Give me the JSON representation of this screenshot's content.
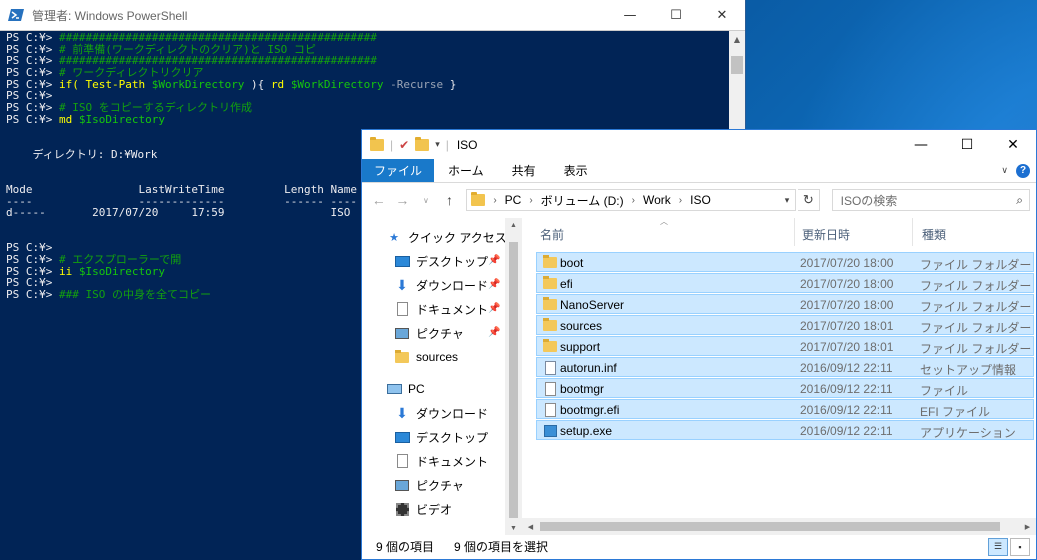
{
  "powershell": {
    "title": "管理者: Windows PowerShell",
    "lines": [
      [
        {
          "t": "PS C:¥> ",
          "c": "c-prompt"
        },
        {
          "t": "################################################",
          "c": "c-comment"
        }
      ],
      [
        {
          "t": "PS C:¥> ",
          "c": "c-prompt"
        },
        {
          "t": "# 前準備(ワークディレクトのクリア)と ISO コピ",
          "c": "c-comment"
        }
      ],
      [
        {
          "t": "PS C:¥> ",
          "c": "c-prompt"
        },
        {
          "t": "################################################",
          "c": "c-comment"
        }
      ],
      [
        {
          "t": "PS C:¥> ",
          "c": "c-prompt"
        },
        {
          "t": "# ワークディレクトリクリア",
          "c": "c-comment"
        }
      ],
      [
        {
          "t": "PS C:¥> ",
          "c": "c-prompt"
        },
        {
          "t": "if( ",
          "c": "c-cmd"
        },
        {
          "t": "Test-Path ",
          "c": "c-cmd"
        },
        {
          "t": "$WorkDirectory",
          "c": "c-var"
        },
        {
          "t": " ){ ",
          "c": "c-text"
        },
        {
          "t": "rd ",
          "c": "c-cmd"
        },
        {
          "t": "$WorkDirectory",
          "c": "c-var"
        },
        {
          "t": " -Recurse",
          "c": "c-param"
        },
        {
          "t": " }",
          "c": "c-text"
        }
      ],
      [
        {
          "t": "PS C:¥> ",
          "c": "c-prompt"
        }
      ],
      [
        {
          "t": "PS C:¥> ",
          "c": "c-prompt"
        },
        {
          "t": "# ISO をコピーするディレクトリ作成",
          "c": "c-comment"
        }
      ],
      [
        {
          "t": "PS C:¥> ",
          "c": "c-prompt"
        },
        {
          "t": "md ",
          "c": "c-cmd"
        },
        {
          "t": "$IsoDirectory",
          "c": "c-var"
        }
      ],
      [],
      [],
      [
        {
          "t": "    ディレクトリ: D:¥Work",
          "c": "c-text"
        }
      ],
      [],
      [],
      [
        {
          "t": "Mode                LastWriteTime         Length Name",
          "c": "c-text"
        }
      ],
      [
        {
          "t": "----                -------------         ------ ----",
          "c": "c-text"
        }
      ],
      [
        {
          "t": "d-----       2017/07/20     17:59                ISO",
          "c": "c-text"
        }
      ],
      [],
      [],
      [
        {
          "t": "PS C:¥> ",
          "c": "c-prompt"
        }
      ],
      [
        {
          "t": "PS C:¥> ",
          "c": "c-prompt"
        },
        {
          "t": "# エクスプローラーで開",
          "c": "c-comment"
        }
      ],
      [
        {
          "t": "PS C:¥> ",
          "c": "c-prompt"
        },
        {
          "t": "ii ",
          "c": "c-cmd"
        },
        {
          "t": "$IsoDirectory",
          "c": "c-var"
        }
      ],
      [
        {
          "t": "PS C:¥> ",
          "c": "c-prompt"
        }
      ],
      [
        {
          "t": "PS C:¥> ",
          "c": "c-prompt"
        },
        {
          "t": "### ISO の中身を全てコピー",
          "c": "c-comment"
        }
      ]
    ]
  },
  "explorer": {
    "title": "ISO",
    "tabs": [
      "ファイル",
      "ホーム",
      "共有",
      "表示"
    ],
    "address": [
      "PC",
      "ボリューム (D:)",
      "Work",
      "ISO"
    ],
    "search_placeholder": "ISOの検索",
    "columns": {
      "name": "名前",
      "date": "更新日時",
      "type": "種類"
    },
    "nav": {
      "quick_access": "クイック アクセス",
      "qa_items": [
        "デスクトップ",
        "ダウンロード",
        "ドキュメント",
        "ピクチャ",
        "sources"
      ],
      "pc": "PC",
      "pc_items": [
        "ダウンロード",
        "デスクトップ",
        "ドキュメント",
        "ピクチャ",
        "ビデオ"
      ]
    },
    "files": [
      {
        "name": "boot",
        "date": "2017/07/20 18:00",
        "type": "ファイル フォルダー",
        "icon": "folder-icon"
      },
      {
        "name": "efi",
        "date": "2017/07/20 18:00",
        "type": "ファイル フォルダー",
        "icon": "folder-icon"
      },
      {
        "name": "NanoServer",
        "date": "2017/07/20 18:00",
        "type": "ファイル フォルダー",
        "icon": "folder-icon"
      },
      {
        "name": "sources",
        "date": "2017/07/20 18:01",
        "type": "ファイル フォルダー",
        "icon": "folder-icon"
      },
      {
        "name": "support",
        "date": "2017/07/20 18:01",
        "type": "ファイル フォルダー",
        "icon": "folder-icon"
      },
      {
        "name": "autorun.inf",
        "date": "2016/09/12 22:11",
        "type": "セットアップ情報",
        "icon": "setup-info-icon"
      },
      {
        "name": "bootmgr",
        "date": "2016/09/12 22:11",
        "type": "ファイル",
        "icon": "file-icon"
      },
      {
        "name": "bootmgr.efi",
        "date": "2016/09/12 22:11",
        "type": "EFI ファイル",
        "icon": "file-icon"
      },
      {
        "name": "setup.exe",
        "date": "2016/09/12 22:11",
        "type": "アプリケーション",
        "icon": "setup-exe-icon"
      }
    ],
    "status": {
      "count": "9 個の項目",
      "selected": "9 個の項目を選択"
    }
  }
}
